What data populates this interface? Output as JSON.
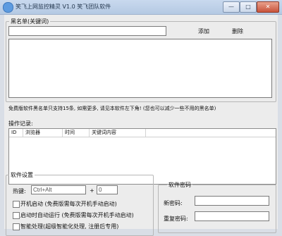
{
  "window": {
    "title": "笑飞上网监控精灵 V1.0 笑飞团队软件",
    "min_glyph": "—",
    "max_glyph": "□",
    "close_glyph": "✕"
  },
  "blacklist": {
    "legend": "黑名单(关键词)",
    "input_value": "",
    "add_label": "添加",
    "delete_label": "删除",
    "notice": "免费版软件黑名单只支持15条, 如需更多, 请见本软件左下角! (您也可以减少一些不用的黑名单)"
  },
  "log": {
    "label": "操作记录:",
    "columns": [
      "ID",
      "浏览器",
      "时间",
      "关键词内容"
    ]
  },
  "settings": {
    "legend": "软件设置",
    "hotkey_label": "热键:",
    "hotkey_value": "Ctrl+Alt",
    "plus": "+",
    "hotkey_key_value": "0",
    "options": [
      "开机启动 (免费版需每次开机手动启动)",
      "启动时自动运行 (免费版需每次开机手动启动)",
      "智能处理(超级智能化处理, 注册后专用)"
    ]
  },
  "password": {
    "legend": "软件密码",
    "new_label": "新密码:",
    "confirm_label": "重复密码:"
  }
}
